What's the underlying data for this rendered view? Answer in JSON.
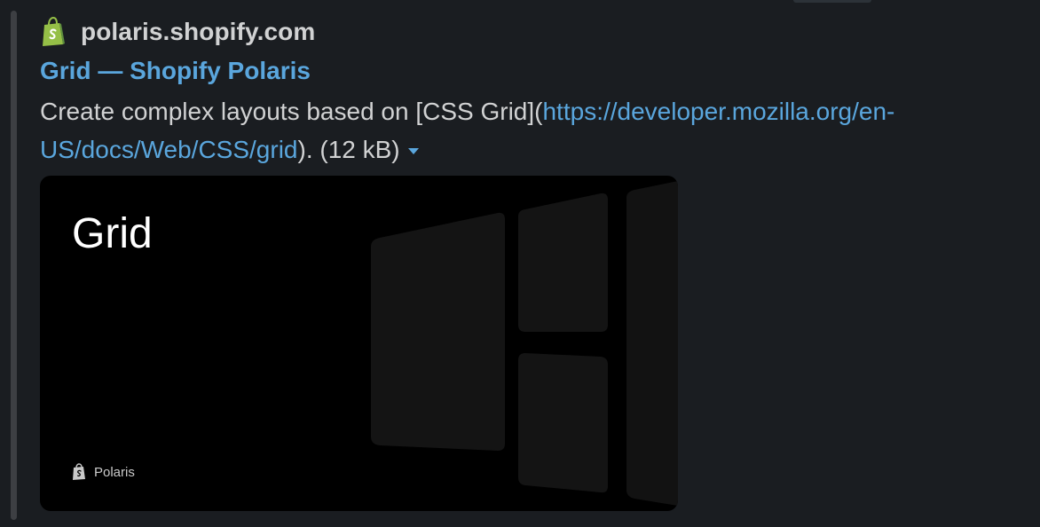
{
  "site": {
    "favicon": "shopify-bag-icon",
    "name": "polaris.shopify.com",
    "accent": "#95bf47"
  },
  "link": {
    "title": "Grid — Shopify Polaris"
  },
  "description": {
    "text_before": "Create complex layouts based on [CSS Grid](",
    "url": "https://developer.mozilla.org/en-US/docs/Web/CSS/grid",
    "text_after": "). (12 kB)",
    "expand_icon": "caret-down-icon"
  },
  "preview": {
    "title": "Grid",
    "brand_icon": "shopify-bag-icon",
    "brand_name": "Polaris",
    "background": "#000000"
  },
  "colors": {
    "background": "#1a1d21",
    "text": "#d1d2d3",
    "link": "#5aa6dd",
    "attachment_bar": "#3d3f43"
  }
}
